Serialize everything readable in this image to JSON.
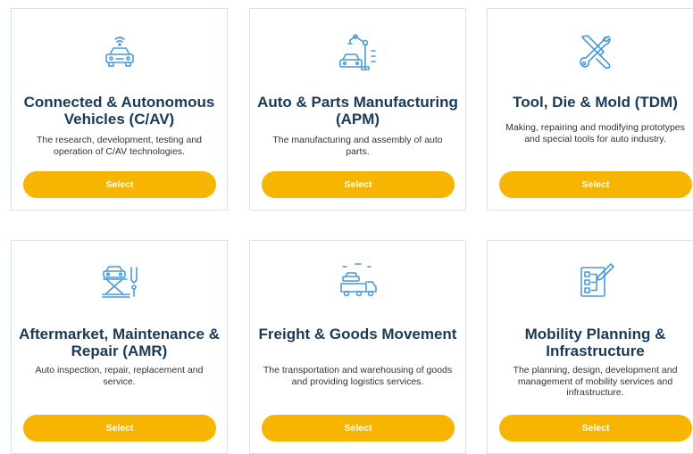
{
  "colors": {
    "accent": "#f7b500",
    "title": "#1b3a57",
    "border": "#cfe3f2",
    "icon": "#4a9ad8"
  },
  "cards": [
    {
      "icon": "connected-car-icon",
      "title": "Connected & Autonomous Vehicles (C/AV)",
      "description": "The research, development, testing and operation of C/AV technologies.",
      "button": "Select"
    },
    {
      "icon": "robot-arm-car-icon",
      "title": "Auto & Parts Manufacturing (APM)",
      "description": "The manufacturing and assembly of auto parts.",
      "button": "Select"
    },
    {
      "icon": "wrench-screwdriver-icon",
      "title": "Tool, Die & Mold (TDM)",
      "description": "Making, repairing and modifying prototypes and special tools for auto industry.",
      "button": "Select"
    },
    {
      "icon": "car-lift-icon",
      "title": "Aftermarket, Maintenance & Repair (AMR)",
      "description": "Auto inspection, repair, replacement and service.",
      "button": "Select"
    },
    {
      "icon": "car-carrier-truck-icon",
      "title": "Freight & Goods Movement",
      "description": "The transportation and warehousing of goods and providing logistics services.",
      "button": "Select"
    },
    {
      "icon": "planning-clipboard-icon",
      "title": "Mobility Planning & Infrastructure",
      "description": "The planning, design, development and management of mobility services and infrastructure.",
      "button": "Select"
    }
  ]
}
